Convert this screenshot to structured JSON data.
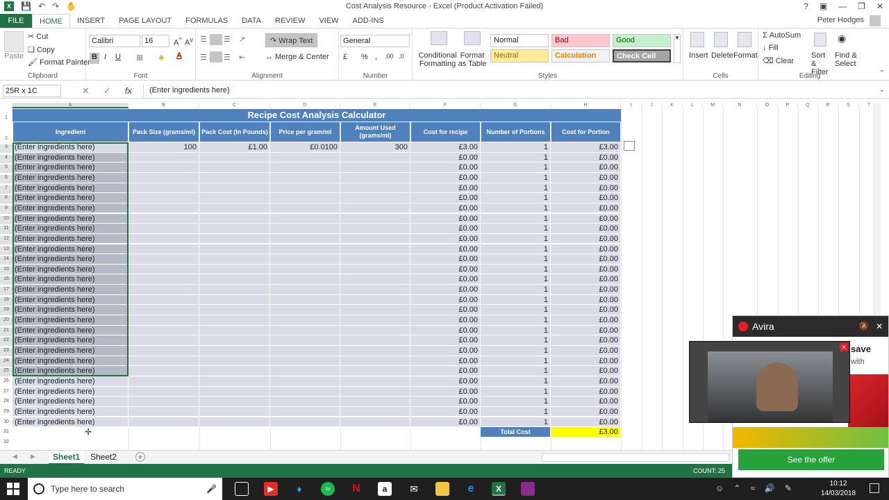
{
  "window": {
    "title": "Cost Analysis Resource - Excel (Product Activation Failed)",
    "user": "Peter Hodges"
  },
  "tabs": [
    "FILE",
    "HOME",
    "INSERT",
    "PAGE LAYOUT",
    "FORMULAS",
    "DATA",
    "REVIEW",
    "VIEW",
    "ADD-INS"
  ],
  "ribbon": {
    "clipboard": {
      "paste": "Paste",
      "cut": "Cut",
      "copy": "Copy",
      "format_painter": "Format Painter",
      "label": "Clipboard"
    },
    "font": {
      "name": "Calibri",
      "size": "16",
      "label": "Font",
      "bold": "B",
      "italic": "I",
      "underline": "U"
    },
    "alignment": {
      "wrap": "Wrap Text",
      "merge": "Merge & Center",
      "label": "Alignment"
    },
    "number": {
      "format": "General",
      "label": "Number",
      "percent": "%"
    },
    "styles": {
      "cond": "Conditional Formatting",
      "fmt_table": "Format as Table",
      "normal": "Normal",
      "bad": "Bad",
      "good": "Good",
      "neutral": "Neutral",
      "calculation": "Calculation",
      "check": "Check Cell",
      "label": "Styles"
    },
    "cells": {
      "insert": "Insert",
      "delete": "Delete",
      "format": "Format",
      "label": "Cells"
    },
    "editing": {
      "autosum": "AutoSum",
      "fill": "Fill",
      "clear": "Clear",
      "sort": "Sort & Filter",
      "find": "Find & Select",
      "label": "Editing"
    }
  },
  "formula_bar": {
    "name_box": "25R x 1C",
    "content": "(Enter ingredients here)",
    "fx": "fx"
  },
  "columns": [
    "A",
    "B",
    "C",
    "D",
    "E",
    "F",
    "G",
    "H",
    "I",
    "J",
    "K",
    "L",
    "M",
    "N",
    "O",
    "P",
    "Q",
    "R",
    "S",
    "T"
  ],
  "sheet": {
    "title": "Recipe Cost Analysis Calculator",
    "headers": [
      "Ingredient",
      "Pack Size (grams/ml)",
      "Pack Cost (In Pounds)",
      "Price per gram/ml",
      "Amount Used (grams/ml)",
      "Cost for recipe",
      "Number of Portions",
      "Cost for Portion"
    ],
    "first_row": {
      "ingredient": "(Enter ingredients here)",
      "pack_size": "100",
      "pack_cost": "£1.00",
      "price_per": "£0.0100",
      "amount": "300",
      "cost_recipe": "£3.00",
      "portions": "1",
      "cost_portion": "£3.00"
    },
    "other_rows": {
      "ingredient": "(Enter ingredients here)",
      "cost_recipe": "£0.00",
      "portions": "1",
      "cost_portion": "£0.00"
    },
    "row_count": 28,
    "total_label": "Total Cost",
    "total_value": "£3.00"
  },
  "sheet_tabs": [
    "Sheet1",
    "Sheet2"
  ],
  "status": {
    "ready": "READY",
    "count": "COUNT: 25"
  },
  "taskbar": {
    "search_placeholder": "Type here to search",
    "time": "10:12",
    "date": "14/03/2018"
  },
  "avira": {
    "brand": "Avira",
    "text1": "save",
    "text2": "with",
    "button": "See the offer"
  }
}
